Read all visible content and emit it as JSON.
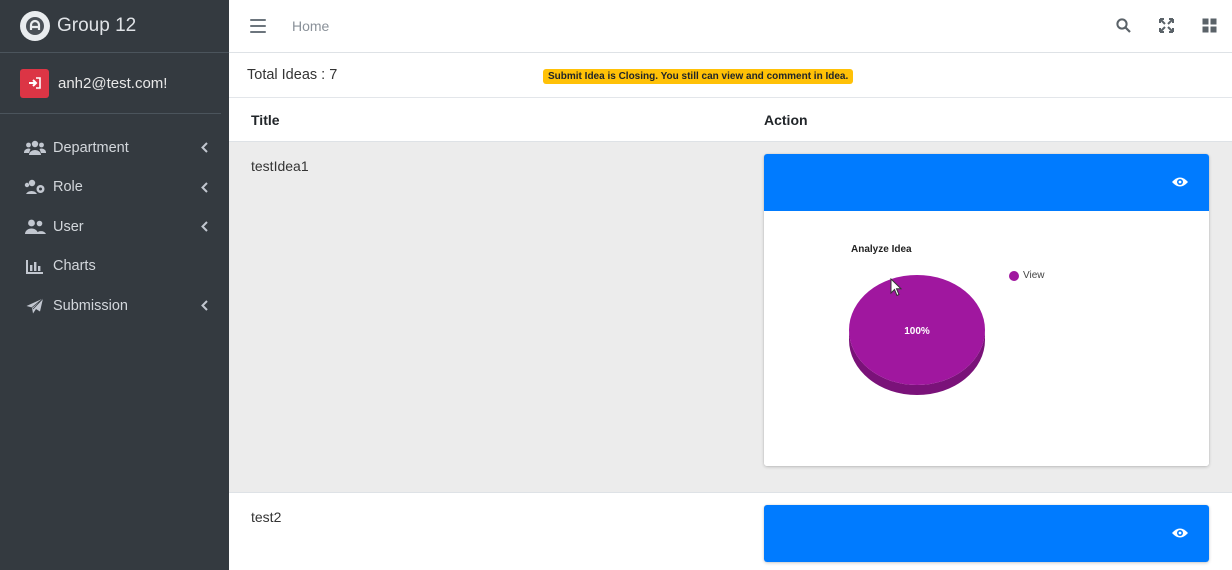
{
  "brand": {
    "name": "Group 12"
  },
  "user": {
    "email": "anh2@test.com!"
  },
  "sidebar": {
    "items": [
      {
        "label": "Department",
        "icon": "users-group-icon",
        "has_submenu": true
      },
      {
        "label": "Role",
        "icon": "users-cog-icon",
        "has_submenu": true
      },
      {
        "label": "User",
        "icon": "user-friends-icon",
        "has_submenu": true
      },
      {
        "label": "Charts",
        "icon": "chart-bar-icon",
        "has_submenu": false
      },
      {
        "label": "Submission",
        "icon": "paper-plane-icon",
        "has_submenu": true
      }
    ]
  },
  "topbar": {
    "home_label": "Home"
  },
  "summary": {
    "total_ideas": "Total Ideas : 7",
    "closing_notice": "Submit Idea is Closing. You still can view and comment in Idea."
  },
  "table": {
    "headers": {
      "title": "Title",
      "action": "Action"
    },
    "rows": [
      {
        "title": "testIdea1",
        "chart": {
          "title": "Analyze Idea",
          "legend": "View",
          "slice_label": "100%"
        }
      },
      {
        "title": "test2"
      }
    ]
  },
  "colors": {
    "sidebar_bg": "#343a40",
    "primary": "#007bff",
    "danger": "#dc3545",
    "warning": "#ffc107",
    "pie_view": "#a0179f",
    "pie_view_side": "#7a1279"
  },
  "chart_data": {
    "type": "pie",
    "title": "Analyze Idea",
    "categories": [
      "View"
    ],
    "values": [
      100
    ],
    "labels": [
      "100%"
    ],
    "legend_position": "top-right",
    "three_d": true
  }
}
